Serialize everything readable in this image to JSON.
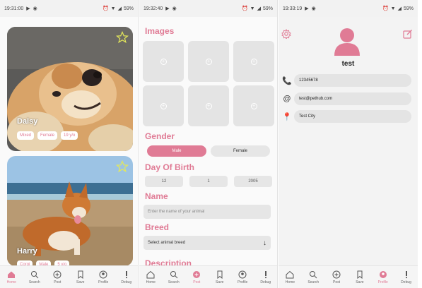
{
  "screen_feed": {
    "status": {
      "time": "19:31:00",
      "battery": "59%"
    },
    "cards": [
      {
        "name": "Daisy",
        "tags": [
          "Mixed",
          "Female",
          "19 y/o"
        ]
      },
      {
        "name": "Harry",
        "tags": [
          "Corgi",
          "Male",
          "5 y/o"
        ]
      }
    ]
  },
  "screen_post": {
    "status": {
      "time": "19:32:40",
      "battery": "59%"
    },
    "images_title": "Images",
    "gender_title": "Gender",
    "gender_options": [
      "Male",
      "Female"
    ],
    "gender_selected": "Male",
    "dob_title": "Day Of Birth",
    "dob": {
      "day": "12",
      "month": "1",
      "year": "2005"
    },
    "name_title": "Name",
    "name_placeholder": "Enter the name of your animal",
    "breed_title": "Breed",
    "breed_placeholder": "Select animal breed",
    "description_title": "Description"
  },
  "screen_profile": {
    "status": {
      "time": "19:33:19",
      "battery": "59%"
    },
    "name": "test",
    "phone": "12345678",
    "email": "test@pethub.com",
    "city": "Test City"
  },
  "nav": {
    "labels": [
      "Home",
      "Search",
      "Post",
      "Save",
      "Profile",
      "Debug"
    ]
  },
  "colors": {
    "accent": "#e07b95",
    "star": "#e4e85a"
  }
}
